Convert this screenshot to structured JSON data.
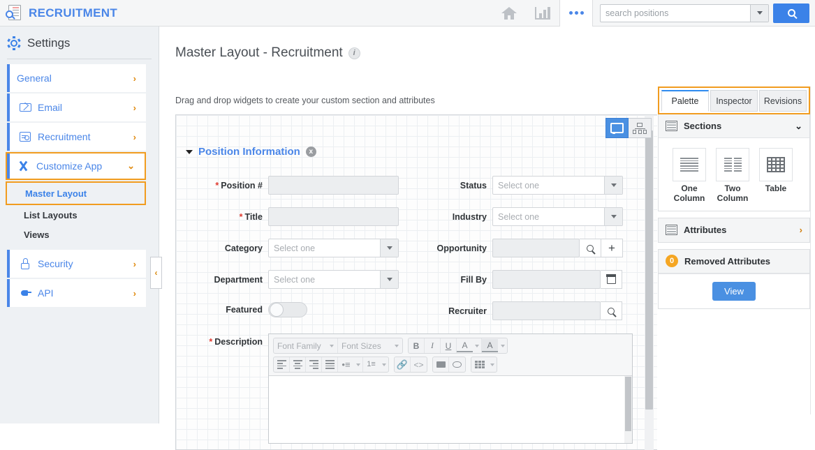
{
  "topbar": {
    "brand": "RECRUITMENT",
    "brand_icon": "document-search-icon",
    "home_icon": "home-icon",
    "reports_icon": "bar-chart-icon",
    "more_icon": "ellipsis-icon",
    "search_placeholder": "search positions",
    "search_value": "",
    "search_button_icon": "search-icon",
    "dropdown_icon": "chevron-down-icon"
  },
  "sidebar": {
    "title": "Settings",
    "gear_icon": "gear-icon",
    "items": [
      {
        "label": "General",
        "icon": "",
        "chevron": "›"
      },
      {
        "label": "Email",
        "icon": "mail-icon",
        "chevron": "›"
      },
      {
        "label": "Recruitment",
        "icon": "recruitment-icon",
        "chevron": "›"
      },
      {
        "label": "Customize App",
        "icon": "tools-icon",
        "chevron": "⌄"
      },
      {
        "label": "Security",
        "icon": "lock-icon",
        "chevron": "›"
      },
      {
        "label": "API",
        "icon": "plug-icon",
        "chevron": "›"
      }
    ],
    "sub_items": [
      {
        "label": "Master Layout",
        "active": true
      },
      {
        "label": "List Layouts",
        "active": false
      },
      {
        "label": "Views",
        "active": false
      }
    ],
    "collapse_handle": "‹",
    "highlight_color": "#f19c1f",
    "accent_color": "#4a86e8"
  },
  "main": {
    "title": "Master Layout - Recruitment",
    "info_icon": "info-icon",
    "subtitle": "Drag and drop widgets to create your custom section and attributes",
    "view_toggle": [
      {
        "name": "desktop-view",
        "icon": "monitor-icon",
        "active": true
      },
      {
        "name": "hierarchy-view",
        "icon": "hierarchy-icon",
        "active": false
      }
    ],
    "section": {
      "title": "Position Information",
      "collapse_icon": "chevron-down-icon",
      "remove_icon": "close-icon",
      "remove_label": "x"
    },
    "fields_left": [
      {
        "label": "Position #",
        "required": true,
        "type": "text",
        "value": ""
      },
      {
        "label": "Title",
        "required": true,
        "type": "text",
        "value": ""
      },
      {
        "label": "Category",
        "required": false,
        "type": "select",
        "placeholder": "Select one"
      },
      {
        "label": "Department",
        "required": false,
        "type": "select",
        "placeholder": "Select one"
      },
      {
        "label": "Featured",
        "required": false,
        "type": "toggle",
        "value": "off"
      }
    ],
    "fields_right": [
      {
        "label": "Status",
        "required": false,
        "type": "select",
        "placeholder": "Select one"
      },
      {
        "label": "Industry",
        "required": false,
        "type": "select",
        "placeholder": "Select one"
      },
      {
        "label": "Opportunity",
        "required": false,
        "type": "lookup-add",
        "value": ""
      },
      {
        "label": "Fill By",
        "required": false,
        "type": "date",
        "value": ""
      },
      {
        "label": "Recruiter",
        "required": false,
        "type": "lookup",
        "value": ""
      }
    ],
    "description": {
      "label": "Description",
      "required": true,
      "font_family": "Font Family",
      "font_sizes": "Font Sizes",
      "bold": "B",
      "italic": "I",
      "underline": "U",
      "text_color": "A",
      "highlight_color": "A",
      "align_left": "align-left-icon",
      "align_center": "align-center-icon",
      "align_right": "align-right-icon",
      "align_justify": "align-justify-icon",
      "bullet_list": "bullet-list-icon",
      "number_list": "numbered-list-icon",
      "link": "link-icon",
      "code": "<>",
      "print": "print-icon",
      "preview": "eye-icon",
      "table": "table-icon",
      "body_value": ""
    }
  },
  "right_panel": {
    "tabs": [
      {
        "label": "Palette",
        "active": true
      },
      {
        "label": "Inspector",
        "active": false
      },
      {
        "label": "Revisions",
        "active": false
      }
    ],
    "sections_panel": {
      "title": "Sections",
      "icon": "sections-icon",
      "chevron": "⌄",
      "widgets": [
        {
          "label": "One Column",
          "icon": "one-column-icon"
        },
        {
          "label": "Two Column",
          "icon": "two-column-icon"
        },
        {
          "label": "Table",
          "icon": "table-grid-icon"
        }
      ]
    },
    "attributes_panel": {
      "title": "Attributes",
      "icon": "attributes-icon",
      "chevron": "›"
    },
    "removed_panel": {
      "title": "Removed Attributes",
      "count": "0",
      "button": "View"
    }
  }
}
